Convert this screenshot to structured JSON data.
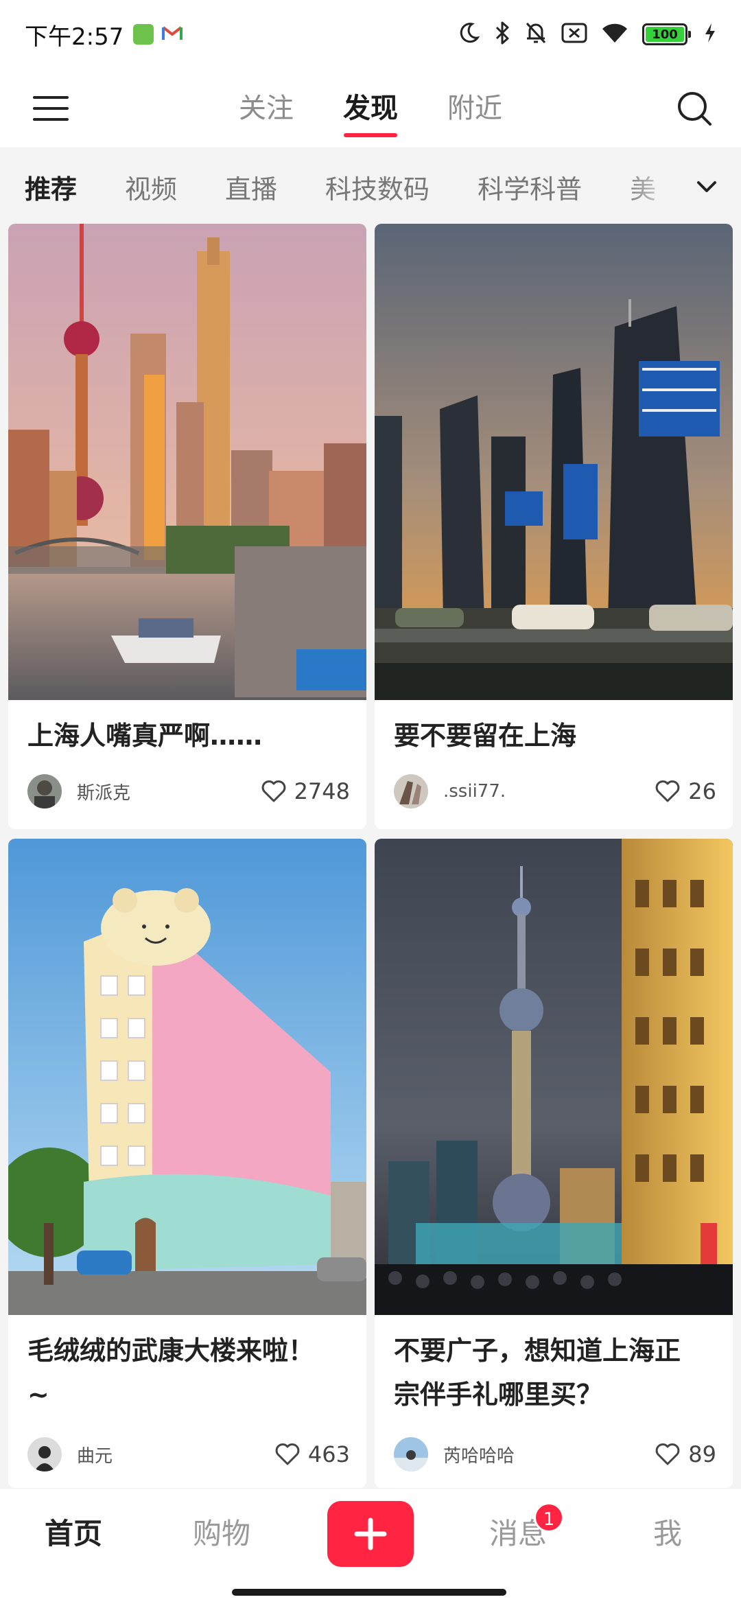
{
  "status_bar": {
    "time": "下午2:57",
    "battery": "100"
  },
  "top_nav": {
    "tabs": [
      {
        "label": "关注"
      },
      {
        "label": "发现"
      },
      {
        "label": "附近"
      }
    ],
    "active_tab": "发现"
  },
  "categories": {
    "items": [
      "推荐",
      "视频",
      "直播",
      "科技数码",
      "科学科普",
      "美"
    ],
    "active": "推荐"
  },
  "feed": {
    "cards": [
      {
        "title": "上海人嘴真严啊……",
        "author": "斯派克",
        "likes": "2748"
      },
      {
        "title": "要不要留在上海",
        "author": ".ssii77.",
        "likes": "26"
      },
      {
        "title": "毛绒绒的武康大楼来啦！",
        "title_line2": "~",
        "author": "曲元",
        "likes": "463"
      },
      {
        "title": "不要广子，想知道上海正",
        "title_line2": "宗伴手礼哪里买？",
        "author": "芮哈哈哈",
        "likes": "89"
      }
    ]
  },
  "tab_bar": {
    "home": "首页",
    "shopping": "购物",
    "messages": "消息",
    "messages_badge": "1",
    "me": "我"
  },
  "colors": {
    "accent": "#ff2442",
    "background": "#f4f4f4"
  },
  "icons": [
    "menu-icon",
    "search-icon",
    "chevron-down-icon",
    "heart-icon",
    "plus-icon",
    "moon-icon",
    "bluetooth-icon",
    "mute-bell-icon",
    "sim-off-icon",
    "wifi-icon",
    "battery-icon",
    "charging-icon"
  ]
}
